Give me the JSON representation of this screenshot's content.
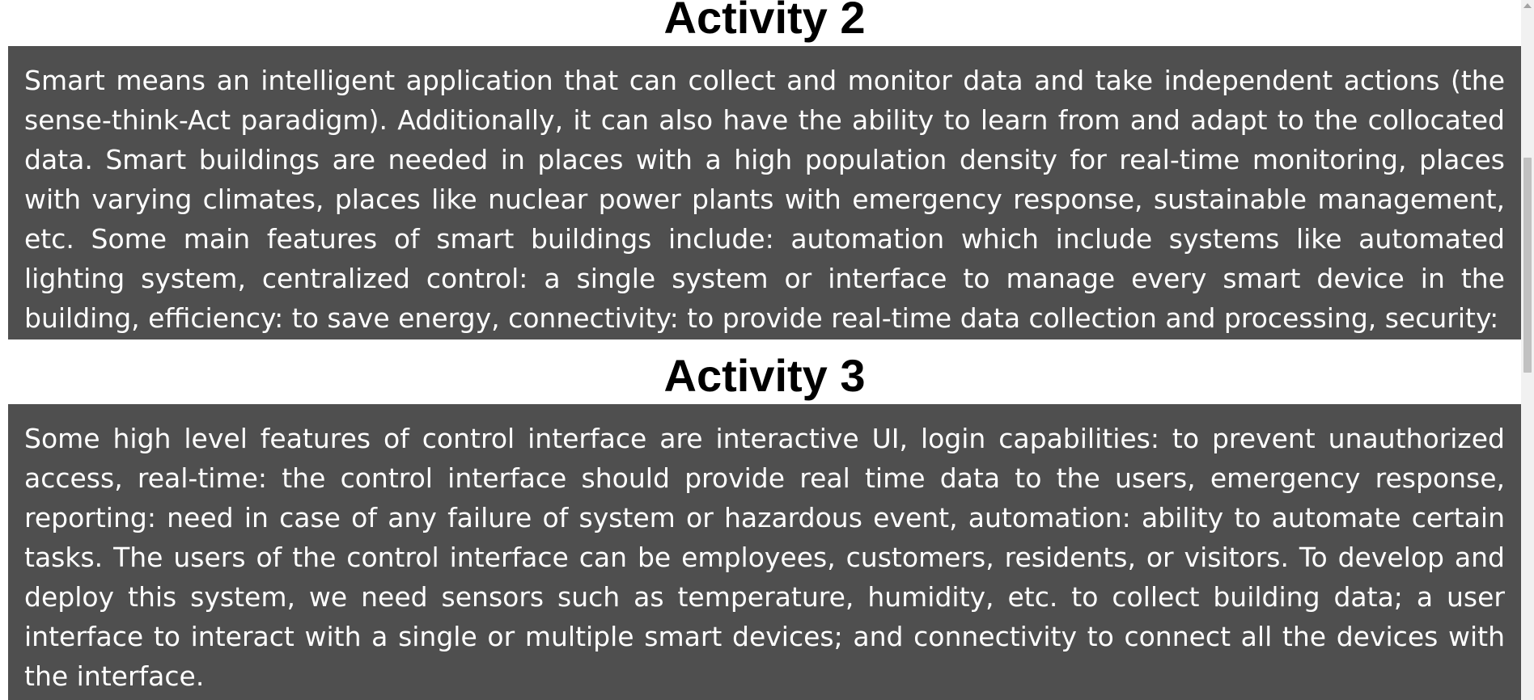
{
  "activities": [
    {
      "title": "Activity 2",
      "text": "Smart means an intelligent application that can collect and monitor data and take independent actions (the sense-think-Act paradigm). Additionally, it can also have the ability to learn from and adapt to the collocated data. Smart buildings are needed in places with a high population density for real-time monitoring, places with varying climates, places like nuclear power plants with emergency response, sustainable management, etc. Some main features of smart buildings include: automation which include systems like automated lighting system, centralized control: a single system or interface to manage every smart device in the building, efficiency: to save energy, connectivity: to provide real-time data collection and processing, security:"
    },
    {
      "title": "Activity 3",
      "text": "Some high level features of control interface are interactive UI, login capabilities: to prevent unauthorized access, real-time: the control interface should provide real time data to the users, emergency response, reporting: need in case of any failure of system or hazardous event, automation: ability to automate certain tasks. The users of the control interface can be employees, customers, residents, or visitors. To develop and deploy this system, we need sensors such as temperature, humidity, etc. to collect building data; a user interface to interact with a single or multiple smart devices; and connectivity to connect all the devices with the interface."
    }
  ],
  "colors": {
    "panel_background": "#4f4f4f",
    "panel_text": "#ffffff",
    "heading_text": "#000000",
    "page_background": "#ffffff"
  },
  "icons": {
    "scroll_up": "scroll-up-arrow-icon"
  }
}
